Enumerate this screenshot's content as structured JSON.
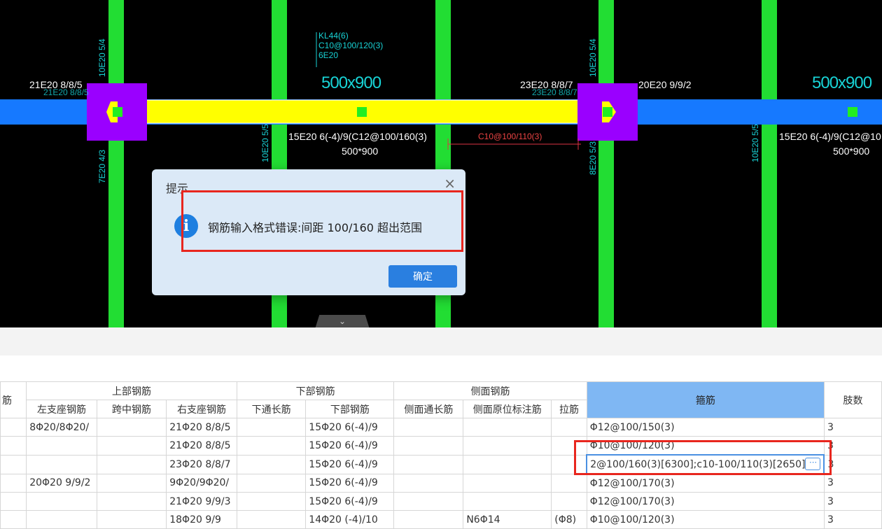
{
  "canvas": {
    "beam_label_lines": [
      "KL44(6)",
      "C10@100/120(3)",
      "6E20"
    ],
    "section_left": "500x900",
    "section_right": "500x900",
    "top_left_rebar": "21E20 8/8/5",
    "top_left_rebar_ghost": "21E20 8/8/5",
    "top_mid_rebar": "23E20 8/8/7",
    "top_mid_rebar_ghost": "23E20 8/8/7",
    "top_right_rebar": "20E20 9/9/2",
    "bottom_rebar": "15E20 6(-4)/9(C12@100/160(3)",
    "bottom_rebar_right": "15E20 6(-4)/9(C12@10",
    "bottom_section": "500*900",
    "bottom_section_right": "500*900",
    "dim_label": "C10@100/110(3)",
    "col_label_1": "10E20 5/4",
    "col_label_2": "7E20 4/3",
    "col_label_3": "10E20 5/5",
    "col_label_4": "10E20 5/4",
    "col_label_5": "8E20 5/3",
    "col_label_6": "10E20 5/5"
  },
  "dialog": {
    "title": "提示",
    "close": "×",
    "icon": "i",
    "message": "钢筋输入格式错误:间距 100/160 超出范围",
    "ok_label": "确定"
  },
  "collapse_glyph": "⌄",
  "table": {
    "group_headers": {
      "left_partial": "筋",
      "top": "上部钢筋",
      "bottom": "下部钢筋",
      "side": "侧面钢筋",
      "stirrup": "箍筋",
      "legs": "肢数"
    },
    "sub_headers": [
      "左支座钢筋",
      "跨中钢筋",
      "右支座钢筋",
      "下通长筋",
      "下部钢筋",
      "侧面通长筋",
      "侧面原位标注筋",
      "拉筋"
    ],
    "rows": [
      [
        "",
        "8Φ20/8Φ20/",
        "",
        "21Φ20 8/8/5",
        "",
        "15Φ20 6(-4)/9",
        "",
        "",
        "",
        "Φ12@100/150(3)",
        "3"
      ],
      [
        "",
        "",
        "",
        "21Φ20 8/8/5",
        "",
        "15Φ20 6(-4)/9",
        "",
        "",
        "",
        "Φ10@100/120(3)",
        "3"
      ],
      [
        "",
        "",
        "",
        "23Φ20 8/8/7",
        "",
        "15Φ20 6(-4)/9",
        "",
        "",
        "",
        "2@100/160(3)[6300];c10-100/110(3)[2650]",
        "3"
      ],
      [
        "",
        "20Φ20 9/9/2",
        "",
        "9Φ20/9Φ20/",
        "",
        "15Φ20 6(-4)/9",
        "",
        "",
        "",
        "Φ12@100/170(3)",
        "3"
      ],
      [
        "",
        "",
        "",
        "21Φ20 9/9/3",
        "",
        "15Φ20 6(-4)/9",
        "",
        "",
        "",
        "Φ12@100/170(3)",
        "3"
      ],
      [
        "",
        "",
        "",
        "18Φ20 9/9",
        "",
        "14Φ20 (-4)/10",
        "",
        "N6Φ14",
        "(Φ8)",
        "Φ10@100/120(3)",
        "3"
      ]
    ],
    "editing_row": 2,
    "ellipsis": "⋯"
  }
}
